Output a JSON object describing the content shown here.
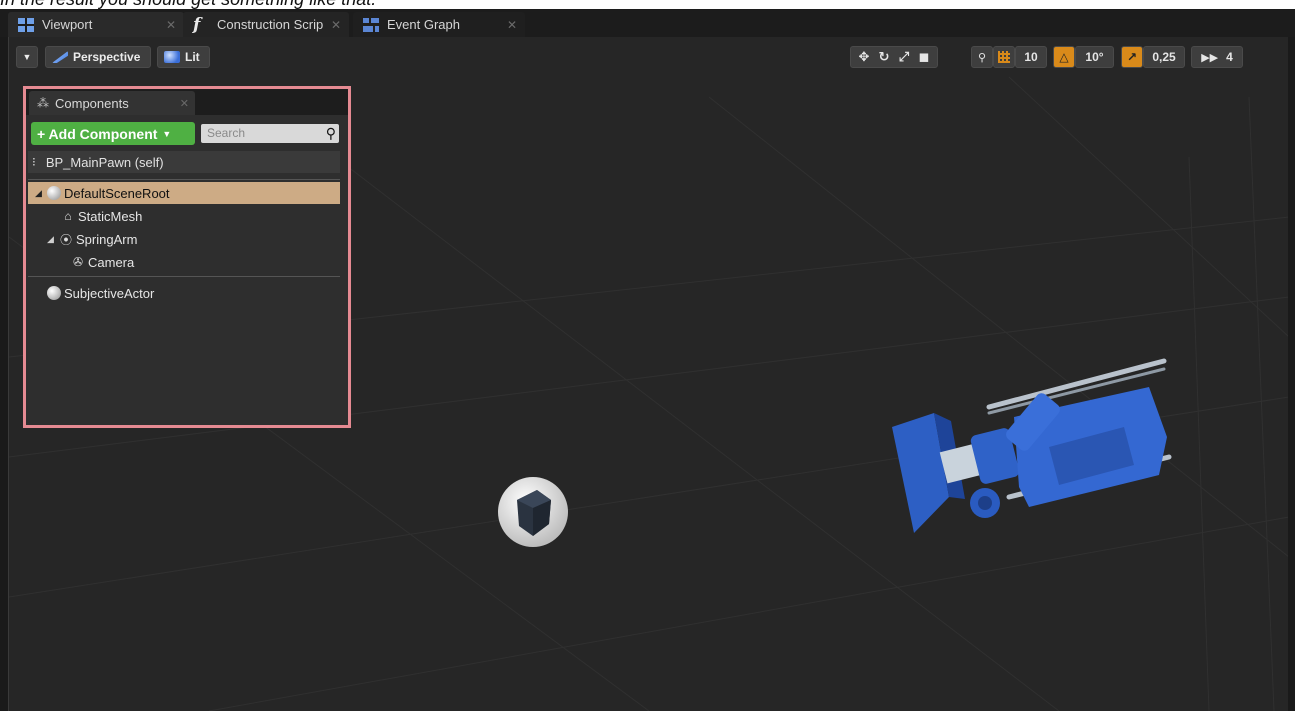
{
  "caption": "In the result you should get something like that:",
  "tabs": [
    {
      "label": "Viewport",
      "icon": "viewport-grid-icon"
    },
    {
      "label": "Construction Scrip",
      "icon": "function-icon"
    },
    {
      "label": "Event Graph",
      "icon": "event-graph-icon"
    }
  ],
  "viewport_controls": {
    "projection": "Perspective",
    "view_mode": "Lit"
  },
  "viewport_toolbar": {
    "grid_snap": "10",
    "rotation_snap": "10°",
    "scale_snap": "0,25",
    "camera_speed": "4",
    "accent_color": "#d98a1a"
  },
  "components_panel": {
    "tab_label": "Components",
    "add_button": "+ Add Component",
    "search_placeholder": "Search",
    "self_label": "BP_MainPawn (self)",
    "tree": [
      {
        "label": "DefaultSceneRoot",
        "icon": "scene-root-icon",
        "selected": true
      },
      {
        "label": "StaticMesh",
        "icon": "static-mesh-icon",
        "selected": false
      },
      {
        "label": "SpringArm",
        "icon": "spring-arm-icon",
        "selected": false
      },
      {
        "label": "Camera",
        "icon": "camera-icon",
        "selected": false
      }
    ],
    "extra": [
      {
        "label": "SubjectiveActor",
        "icon": "actor-icon"
      }
    ],
    "border_color": "#e58a92",
    "add_button_color": "#4fb043",
    "selected_row_color": "#cdab85"
  }
}
